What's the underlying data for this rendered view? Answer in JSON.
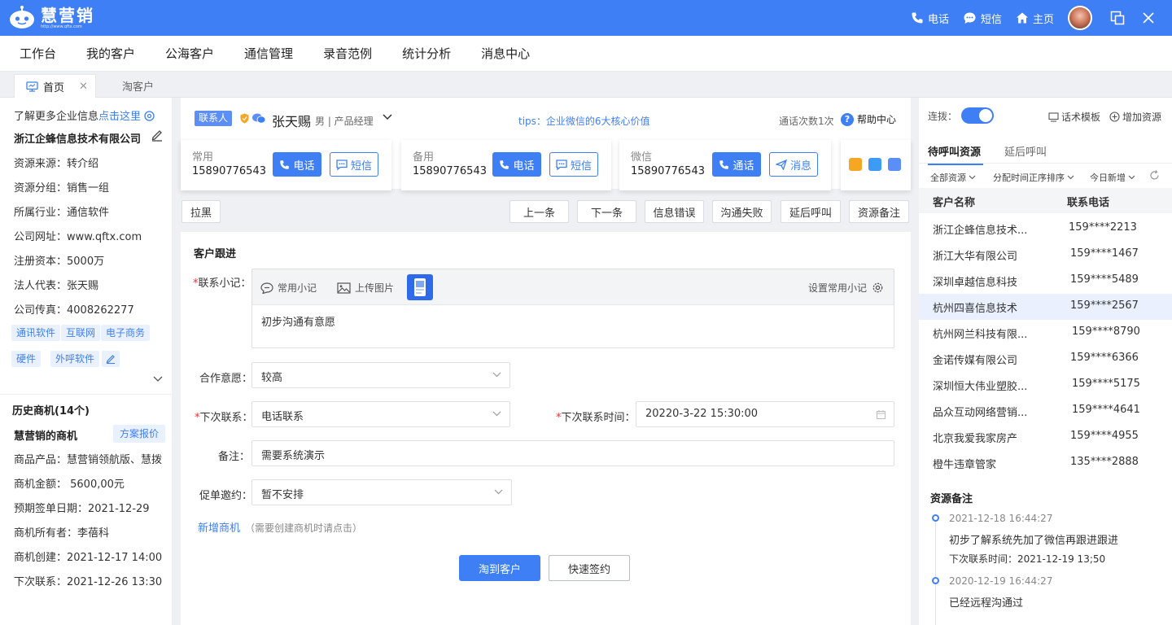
{
  "app": {
    "title": "慧营销",
    "url": "http://www.qftx.com"
  },
  "topbar": {
    "phone": "电话",
    "sms": "短信",
    "home": "主页"
  },
  "nav": {
    "items": [
      "工作台",
      "我的客户",
      "公海客户",
      "通信管理",
      "录音范例",
      "统计分析",
      "消息中心"
    ]
  },
  "tabs": {
    "active": "首页",
    "inactive": "淘客户"
  },
  "company": {
    "intro_prefix": "了解更多企业信息",
    "intro_link": "点击这里",
    "name": "浙江企蜂信息技术有限公司",
    "fields": [
      "资源来源：转介绍",
      "资源分组：销售一组",
      "所属行业：通信软件",
      "公司网址：www.qftx.com",
      "注册资本：5000万",
      "法人代表：张天赐",
      "公司传真：4008262277"
    ],
    "tags_row1": [
      "通讯软件",
      "互联网",
      "电子商务"
    ],
    "tags_row2": [
      "硬件",
      "外呼软件"
    ]
  },
  "history": {
    "title": "历史商机(14个)",
    "opp_title": "慧营销的商机",
    "plan_button": "方案报价",
    "fields": [
      "商品产品：慧营销领航版、慧拨",
      "商机金额：  5600,00元",
      "预期签单日期：2021-12-29",
      "商机所有者：李蓓科",
      "商机创建：2021-12-17 14:00",
      "下次联系：2021-12-26 13:30"
    ]
  },
  "contact": {
    "badge": "联系人",
    "name": "张天赐",
    "gender_title": "男 | 产品经理",
    "tips": "tips：企业微信的6大核心价值",
    "call_count": "通话次数1次",
    "help": "帮助中心"
  },
  "phones": [
    {
      "label": "常用",
      "number": "15890776543",
      "call": "电话",
      "sms": "短信"
    },
    {
      "label": "备用",
      "number": "15890776543",
      "call": "电话",
      "sms": "短信"
    },
    {
      "label": "微信",
      "number": "15890776543",
      "call": "通话",
      "sms": "消息"
    }
  ],
  "actions": {
    "blacklist": "拉黑",
    "buttons": [
      "上一条",
      "下一条",
      "信息错误",
      "沟通失败",
      "延后呼叫",
      "资源备注"
    ]
  },
  "followup": {
    "title": "客户跟进",
    "note_label": "联系小记：",
    "common_note": "常用小记",
    "upload": "上传图片",
    "set_common": "设置常用小记",
    "note_text": "初步沟通有意愿",
    "coop_label": "合作意愿：",
    "coop_value": "较高",
    "next_label": "下次联系：",
    "next_value": "电话联系",
    "next_time_label": "下次联系时间：",
    "next_time_value": "20220-3-22 15:30:00",
    "remark_label": "备注：",
    "remark_value": "需要系统演示",
    "promo_label": "促单邀约：",
    "promo_value": "暂不安排",
    "add_opp": "新增商机",
    "add_opp_hint": "（需要创建商机时请点击）",
    "submit": "淘到客户",
    "quick_sign": "快速签约"
  },
  "right": {
    "connect": "连拨：",
    "script": "话术模板",
    "add_resource": "增加资源",
    "tab_active": "待呼叫资源",
    "tab_inactive": "延后呼叫",
    "filters": [
      "全部资源",
      "分配时间正序排序",
      "今日新增"
    ],
    "col_name": "客户名称",
    "col_phone": "联系电话",
    "rows": [
      {
        "name": "浙江企蜂信息技术...",
        "phone": "159****2213"
      },
      {
        "name": "浙江大华有限公司",
        "phone": "159****1467"
      },
      {
        "name": "深圳卓越信息科技",
        "phone": "159****5489"
      },
      {
        "name": "杭州四喜信息技术",
        "phone": "159****2567"
      },
      {
        "name": "杭州网兰科技有限...",
        "phone": "159****8790"
      },
      {
        "name": "金诺传媒有限公司",
        "phone": "159****6366"
      },
      {
        "name": "深圳恒大伟业塑胶...",
        "phone": "159****5175"
      },
      {
        "name": "品众互动网络营销...",
        "phone": "159****4641"
      },
      {
        "name": "北京我爱我家房产",
        "phone": "159****4955"
      },
      {
        "name": "橙牛违章管家",
        "phone": "135****2888"
      }
    ],
    "selected_row": "杭州四喜信息技术",
    "remarks_title": "资源备注",
    "remarks": [
      {
        "time": "2021-12-18  16:44:27",
        "text": "初步了解系统先加了微信再跟进跟进",
        "next": "下次联系时间：2021-12-19 13;50"
      },
      {
        "time": "2020-12-19 16:44:27",
        "text": "已经远程沟通过"
      }
    ]
  },
  "colors": {
    "primary": "#3e7ff5",
    "background": "#eef0f4",
    "required": "#e33"
  }
}
